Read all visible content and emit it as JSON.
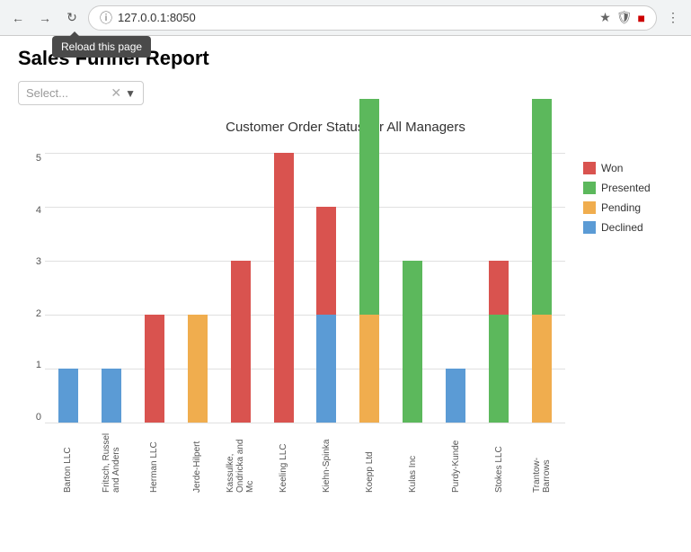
{
  "browser": {
    "url": "127.0.0.1:8050",
    "reload_tooltip": "Reload this page"
  },
  "page": {
    "title": "Sales Funnel Report",
    "select_placeholder": "Select...",
    "chart_title": "Customer Order Status for All Managers"
  },
  "legend": {
    "items": [
      {
        "label": "Won",
        "color": "#d9534f"
      },
      {
        "label": "Presented",
        "color": "#5cb85c"
      },
      {
        "label": "Pending",
        "color": "#f0ad4e"
      },
      {
        "label": "Declined",
        "color": "#5b9bd5"
      }
    ]
  },
  "y_axis": {
    "labels": [
      "0",
      "1",
      "2",
      "3",
      "4",
      "5"
    ]
  },
  "bars": [
    {
      "name": "Barton LLC",
      "won": 0,
      "presented": 0,
      "pending": 0,
      "declined": 1
    },
    {
      "name": "Fritsch, Russel and Anders",
      "won": 0,
      "presented": 0,
      "pending": 0,
      "declined": 1
    },
    {
      "name": "Herman LLC",
      "won": 2,
      "presented": 0,
      "pending": 0,
      "declined": 0
    },
    {
      "name": "Jerde-Hilpert",
      "won": 0,
      "presented": 0,
      "pending": 2,
      "declined": 0
    },
    {
      "name": "Kassulke, Ondricka and Mc",
      "won": 3,
      "presented": 0,
      "pending": 0,
      "declined": 0
    },
    {
      "name": "Keeling LLC",
      "won": 5,
      "presented": 0,
      "pending": 0,
      "declined": 0
    },
    {
      "name": "Kiehn-Spinka",
      "won": 2,
      "presented": 0,
      "pending": 0,
      "declined": 2
    },
    {
      "name": "Koepp Ltd",
      "won": 0,
      "presented": 4,
      "pending": 2,
      "declined": 0
    },
    {
      "name": "Kulas Inc",
      "won": 0,
      "presented": 3,
      "pending": 0,
      "declined": 0
    },
    {
      "name": "Purdy-Kunde",
      "won": 0,
      "presented": 0,
      "pending": 0,
      "declined": 1
    },
    {
      "name": "Stokes LLC",
      "won": 1,
      "presented": 2,
      "pending": 0,
      "declined": 0
    },
    {
      "name": "Trantow-Barrows",
      "won": 0,
      "presented": 4,
      "pending": 2,
      "declined": 0
    }
  ],
  "colors": {
    "won": "#d9534f",
    "presented": "#5cb85c",
    "pending": "#f0ad4e",
    "declined": "#5b9bd5"
  }
}
